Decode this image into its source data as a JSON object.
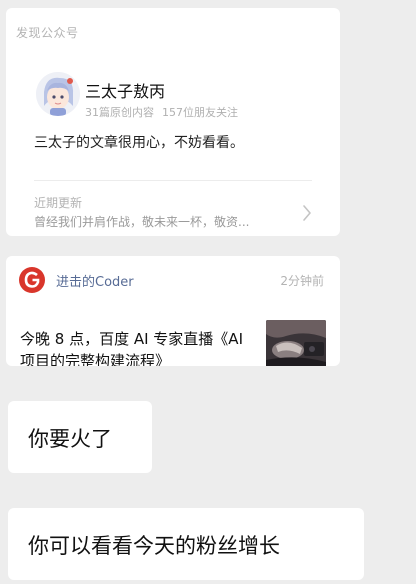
{
  "discover": {
    "section_label": "发现公众号",
    "account_name": "三太子敖丙",
    "articles_count": "31篇原创内容",
    "followers": "157位朋友关注",
    "description": "三太子的文章很用心，不妨看看。",
    "recent_label": "近期更新",
    "recent_text": "曾经我们并肩作战，敬未来一杯，敬资..."
  },
  "article": {
    "source": "进击的Coder",
    "time": "2分钟前",
    "title": "今晚 8 点，百度 AI 专家直播《AI 项目的完整构建流程》"
  },
  "messages": [
    {
      "text": "你要火了"
    },
    {
      "text": "你可以看看今天的粉丝增长"
    }
  ],
  "colors": {
    "background": "#ededed",
    "card": "#ffffff",
    "link": "#576b95",
    "logo_red": "#d9362b"
  },
  "icons": {
    "avatar": "cartoon-avatar",
    "logo": "coder-logo-icon",
    "chevron": "chevron-right-icon"
  }
}
